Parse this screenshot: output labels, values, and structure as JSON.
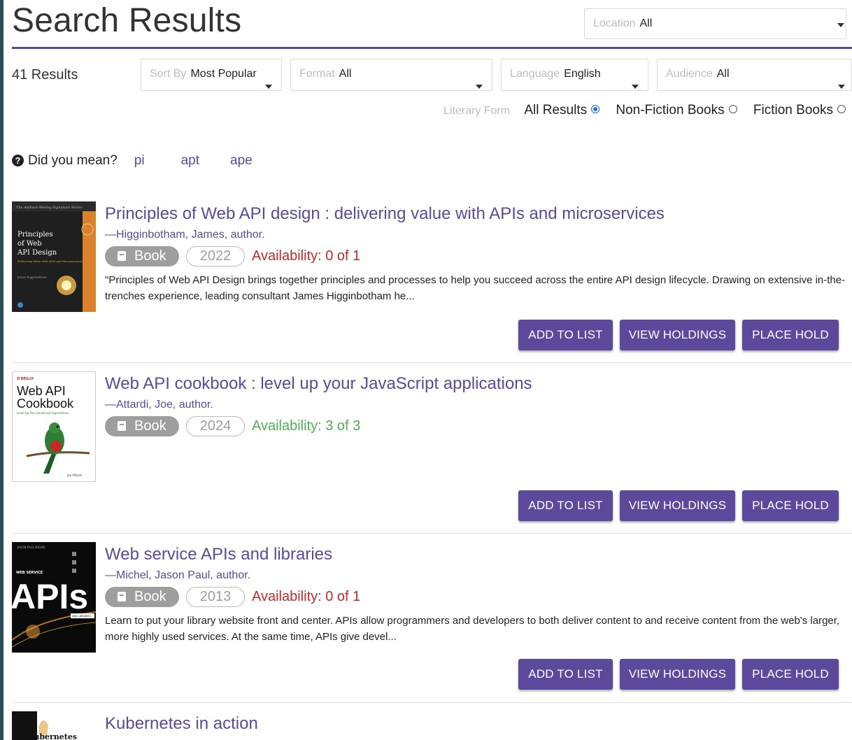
{
  "header": {
    "title": "Search Results",
    "location": {
      "label": "Location",
      "value": "All"
    }
  },
  "filters": {
    "count": "41 Results",
    "sort": {
      "label": "Sort By",
      "value": "Most Popular"
    },
    "format": {
      "label": "Format",
      "value": "All"
    },
    "language": {
      "label": "Language",
      "value": "English"
    },
    "audience": {
      "label": "Audience",
      "value": "All"
    },
    "literary_form": {
      "label": "Literary Form",
      "options": [
        {
          "label": "All Results",
          "selected": true
        },
        {
          "label": "Non-Fiction Books",
          "selected": false
        },
        {
          "label": "Fiction Books",
          "selected": false
        }
      ]
    }
  },
  "did_you_mean": {
    "label": "Did you mean?",
    "suggestions": [
      "pi",
      "apt",
      "ape"
    ]
  },
  "buttons": {
    "add_to_list": "ADD TO LIST",
    "view_holdings": "VIEW HOLDINGS",
    "place_hold": "PLACE HOLD"
  },
  "results": [
    {
      "title": "Principles of Web API design : delivering value with APIs and microservices",
      "author": "—Higginbotham, James, author.",
      "format": "Book",
      "year": "2022",
      "availability": "Availability: 0 of 1",
      "available": false,
      "description": "\"Principles of Web API Design brings together principles and processes to help you succeed across the entire API design lifecycle. Drawing on extensive in-the-trenches experience, leading consultant James Higginbotham he...",
      "cover": {
        "series": "The Addison-Wesley Signature Series",
        "lines": [
          "Principles",
          "of Web",
          "API Design"
        ],
        "subtitle": "Delivering Value with APIs and Microservices",
        "author": "James Higginbotham"
      }
    },
    {
      "title": "Web API cookbook : level up your JavaScript applications",
      "author": "—Attardi, Joe, author.",
      "format": "Book",
      "year": "2024",
      "availability": "Availability: 3 of 3",
      "available": true,
      "description": "",
      "cover": {
        "publisher": "O'REILLY",
        "lines": [
          "Web API",
          "Cookbook"
        ],
        "subtitle": "Level Up Your JavaScript Applications",
        "author": "Joe Attardi"
      }
    },
    {
      "title": "Web service APIs and libraries",
      "author": "—Michel, Jason Paul, author.",
      "format": "Book",
      "year": "2013",
      "availability": "Availability: 0 of 1",
      "available": false,
      "description": "Learn to put your library website front and center. APIs allow programmers and developers to both deliver content to and receive content from the web's larger, more highly used services. At the same time, APIs give devel...",
      "cover": {
        "top": "JASON PAUL MICHEL",
        "label": "WEB SERVICE",
        "big": "APIs",
        "bottom": "AND LIBRARIES"
      }
    },
    {
      "title": "Kubernetes in action",
      "cover": {
        "word": "Kubernetes"
      }
    }
  ],
  "colors": {
    "accent": "#5b4a9b",
    "unavailable": "#c62828",
    "available": "#4caf50"
  }
}
